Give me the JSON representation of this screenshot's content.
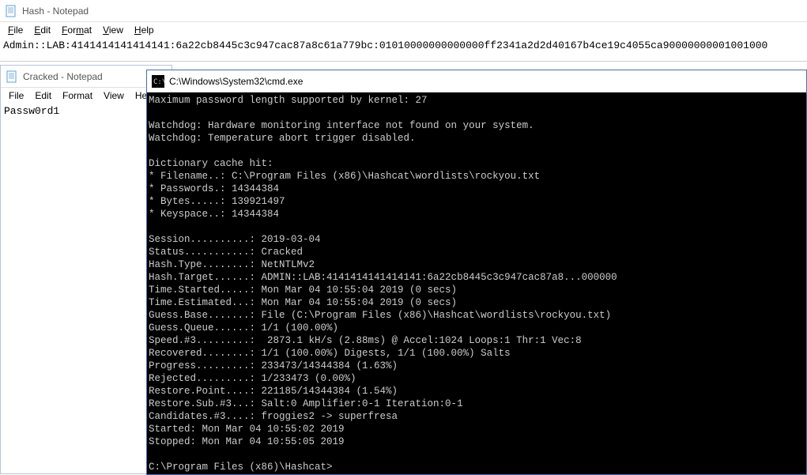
{
  "hash_window": {
    "title": "Hash - Notepad",
    "menu": {
      "file": "File",
      "edit": "Edit",
      "format": "Format",
      "view": "View",
      "help": "Help"
    },
    "content": "Admin::LAB:4141414141414141:6a22cb8445c3c947cac87a8c61a779bc:01010000000000000ff2341a2d2d40167b4ce19c4055ca90000000001001000"
  },
  "cracked_window": {
    "title": "Cracked - Notepad",
    "menu": {
      "file": "File",
      "edit": "Edit",
      "format": "Format",
      "view": "View",
      "help": "Help"
    },
    "content": "Passw0rd1"
  },
  "cmd_window": {
    "title": "C:\\Windows\\System32\\cmd.exe",
    "lines": [
      "Maximum password length supported by kernel: 27",
      "",
      "Watchdog: Hardware monitoring interface not found on your system.",
      "Watchdog: Temperature abort trigger disabled.",
      "",
      "Dictionary cache hit:",
      "* Filename..: C:\\Program Files (x86)\\Hashcat\\wordlists\\rockyou.txt",
      "* Passwords.: 14344384",
      "* Bytes.....: 139921497",
      "* Keyspace..: 14344384",
      "",
      "Session..........: 2019-03-04",
      "Status...........: Cracked",
      "Hash.Type........: NetNTLMv2",
      "Hash.Target......: ADMIN::LAB:4141414141414141:6a22cb8445c3c947cac87a8...000000",
      "Time.Started.....: Mon Mar 04 10:55:04 2019 (0 secs)",
      "Time.Estimated...: Mon Mar 04 10:55:04 2019 (0 secs)",
      "Guess.Base.......: File (C:\\Program Files (x86)\\Hashcat\\wordlists\\rockyou.txt)",
      "Guess.Queue......: 1/1 (100.00%)",
      "Speed.#3.........:  2873.1 kH/s (2.88ms) @ Accel:1024 Loops:1 Thr:1 Vec:8",
      "Recovered........: 1/1 (100.00%) Digests, 1/1 (100.00%) Salts",
      "Progress.........: 233473/14344384 (1.63%)",
      "Rejected.........: 1/233473 (0.00%)",
      "Restore.Point....: 221185/14344384 (1.54%)",
      "Restore.Sub.#3...: Salt:0 Amplifier:0-1 Iteration:0-1",
      "Candidates.#3....: froggies2 -> superfresa",
      "Started: Mon Mar 04 10:55:02 2019",
      "Stopped: Mon Mar 04 10:55:05 2019",
      "",
      "C:\\Program Files (x86)\\Hashcat>"
    ]
  }
}
